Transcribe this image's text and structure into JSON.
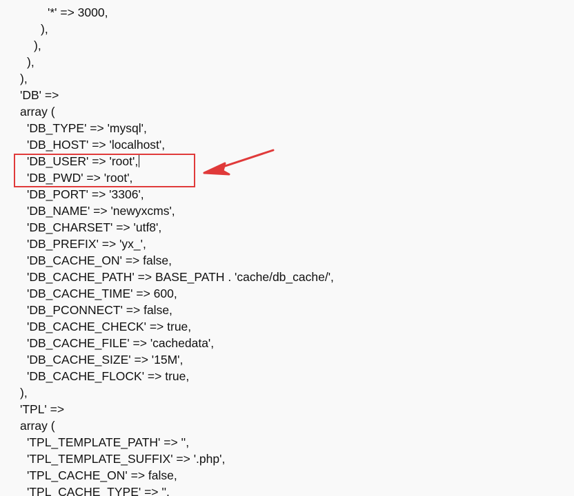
{
  "editor": {
    "lines": [
      {
        "indent": 4,
        "text": "'*' => 3000,"
      },
      {
        "indent": 3,
        "text": "),"
      },
      {
        "indent": 2,
        "text": "),"
      },
      {
        "indent": 1,
        "text": "),"
      },
      {
        "indent": 0,
        "text": "),"
      },
      {
        "indent": 0,
        "text": "'DB' =>"
      },
      {
        "indent": 0,
        "text": "array ("
      },
      {
        "indent": 1,
        "text": "'DB_TYPE' => 'mysql',"
      },
      {
        "indent": 1,
        "text": "'DB_HOST' => 'localhost',"
      },
      {
        "indent": 1,
        "text": "'DB_USER' => 'root',"
      },
      {
        "indent": 1,
        "text": "'DB_PWD' => 'root',"
      },
      {
        "indent": 1,
        "text": "'DB_PORT' => '3306',"
      },
      {
        "indent": 1,
        "text": "'DB_NAME' => 'newyxcms',"
      },
      {
        "indent": 1,
        "text": "'DB_CHARSET' => 'utf8',"
      },
      {
        "indent": 1,
        "text": "'DB_PREFIX' => 'yx_',"
      },
      {
        "indent": 1,
        "text": "'DB_CACHE_ON' => false,"
      },
      {
        "indent": 1,
        "text": "'DB_CACHE_PATH' => BASE_PATH . 'cache/db_cache/',"
      },
      {
        "indent": 1,
        "text": "'DB_CACHE_TIME' => 600,"
      },
      {
        "indent": 1,
        "text": "'DB_PCONNECT' => false,"
      },
      {
        "indent": 1,
        "text": "'DB_CACHE_CHECK' => true,"
      },
      {
        "indent": 1,
        "text": "'DB_CACHE_FILE' => 'cachedata',"
      },
      {
        "indent": 1,
        "text": "'DB_CACHE_SIZE' => '15M',"
      },
      {
        "indent": 1,
        "text": "'DB_CACHE_FLOCK' => true,"
      },
      {
        "indent": 0,
        "text": "),"
      },
      {
        "indent": 0,
        "text": "'TPL' =>"
      },
      {
        "indent": 0,
        "text": "array ("
      },
      {
        "indent": 1,
        "text": "'TPL_TEMPLATE_PATH' => '',"
      },
      {
        "indent": 1,
        "text": "'TPL_TEMPLATE_SUFFIX' => '.php',"
      },
      {
        "indent": 1,
        "text": "'TPL_CACHE_ON' => false,"
      },
      {
        "indent": 1,
        "text": "'TPL_CACHE_TYPE' => '',"
      }
    ],
    "cursor_line": 9
  },
  "annotation": {
    "box_color": "#e03a3a",
    "arrow_color": "#e03a3a",
    "highlighted_lines": [
      9,
      10
    ]
  }
}
